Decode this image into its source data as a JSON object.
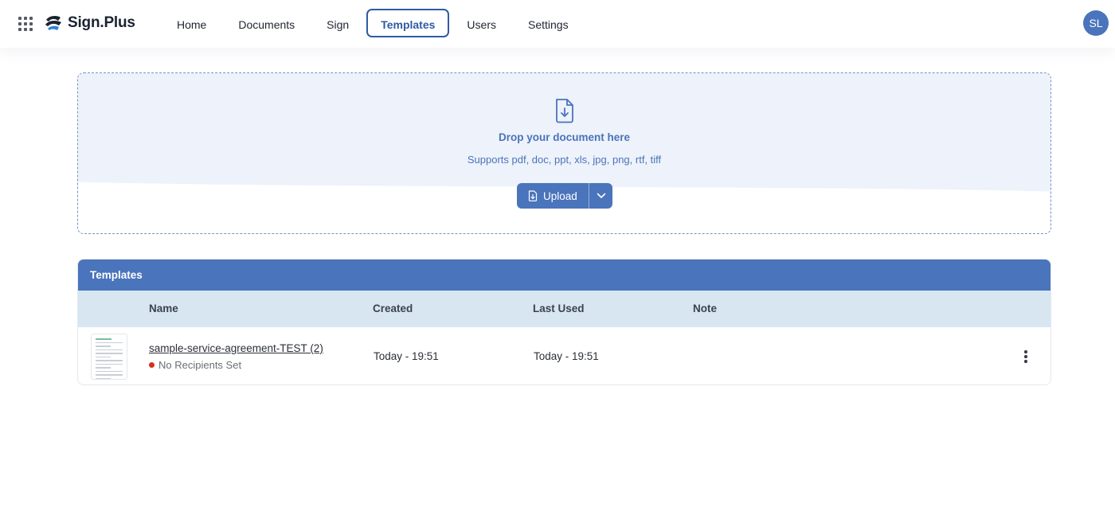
{
  "header": {
    "logo_text": "Sign.Plus",
    "nav": [
      {
        "label": "Home"
      },
      {
        "label": "Documents"
      },
      {
        "label": "Sign"
      },
      {
        "label": "Templates",
        "active": true
      },
      {
        "label": "Users"
      },
      {
        "label": "Settings"
      }
    ],
    "avatar_initials": "SL"
  },
  "dropzone": {
    "icon": "file-download-icon",
    "title": "Drop your document here",
    "subtitle": "Supports pdf, doc, ppt, xls, jpg, png, rtf, tiff",
    "upload_label": "Upload"
  },
  "templates": {
    "title": "Templates",
    "columns": [
      "Name",
      "Created",
      "Last Used",
      "Note"
    ],
    "rows": [
      {
        "name": "sample-service-agreement-TEST (2)",
        "status": "No Recipients Set",
        "created": "Today - 19:51",
        "last_used": "Today - 19:51",
        "note": ""
      }
    ]
  },
  "colors": {
    "primary": "#4a74bb",
    "active_nav": "#2f5ba3",
    "column_header_bg": "#d7e6f1",
    "status_dot": "#d6301f"
  }
}
